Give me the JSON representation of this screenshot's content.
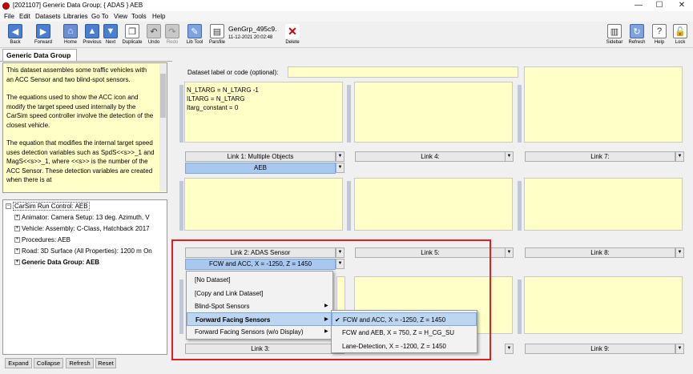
{
  "window": {
    "title": "[2021107] Generic Data Group; { ADAS } AEB",
    "minimize": "—",
    "maximize": "☐",
    "close": "✕"
  },
  "menu": [
    "File",
    "Edit",
    "Datasets",
    "Libraries",
    "Go To",
    "View",
    "Tools",
    "Help"
  ],
  "toolbar": {
    "back": "Back",
    "forward": "Forward",
    "home": "Home",
    "previous": "Previous",
    "next": "Next",
    "duplicate": "Duplicate",
    "undo": "Undo",
    "redo": "Redo",
    "libtool": "Lib Tool",
    "parsfile": "Parsfile",
    "dataset_name": "GenGrp_495c9.",
    "dataset_date": "11-12-2021 20:02:48",
    "delete": "Delete",
    "sidebar": "Sidebar",
    "refresh": "Refresh",
    "help": "Help",
    "lock": "Lock"
  },
  "left": {
    "tab": "Generic Data Group",
    "notes": [
      "This dataset assembles some traffic vehicles with an ACC Sensor and two blind-spot sensors.",
      "The equations used to show the ACC icon and modify the target speed used internally by the CarSim speed controller involve the detection of the closest vehicle.",
      "The equation that modifies the internal target speed uses detection variables such as SpdS<<s>>_1 and MagS<<s>>_1, where <<s>> is the number of the ACC Sensor. These detection variables are created when there is at"
    ],
    "tree": [
      "CarSim Run Control: AEB",
      "Animator: Camera Setup: 13 deg. Azimuth, V",
      "Vehicle: Assembly: C-Class, Hatchback 2017",
      "Procedures: AEB",
      "Road: 3D Surface (All Properties): 1200 m On",
      "Generic Data Group: AEB"
    ],
    "buttons": {
      "expand": "Expand",
      "collapse": "Collapse",
      "refresh": "Refresh",
      "reset": "Reset"
    }
  },
  "right": {
    "dataset_label": "Dataset label or code (optional):",
    "equations": [
      "N_LTARG = N_LTARG -1",
      "ILTARG = N_LTARG",
      "Itarg_constant = 0"
    ],
    "links": {
      "link1": "Link 1: Multiple Objects",
      "link1_value": "AEB",
      "link4": "Link 4:",
      "link7": "Link 7:",
      "link2": "Link 2: ADAS Sensor",
      "link2_value": "FCW and ACC, X = -1250, Z = 1450",
      "link5": "Link 5:",
      "link8": "Link 8:",
      "link3": "Link 3:",
      "link9": "Link 9:"
    }
  },
  "context_menu": {
    "items": [
      "[No Dataset]",
      "[Copy and Link Dataset]",
      "Blind-Spot Sensors",
      "Forward Facing Sensors",
      "Forward Facing Sensors (w/o Display)"
    ],
    "submenu": [
      "FCW and ACC, X = -1250, Z = 1450",
      "FCW and AEB, X = 750, Z = H_CG_SU",
      "Lane-Detection, X = -1200, Z = 1450"
    ],
    "check": "✔",
    "arrow": "▶"
  },
  "colors": {
    "highlight": "#e02020",
    "note_bg": "#ffffc8",
    "selected": "#a8c8f0"
  }
}
